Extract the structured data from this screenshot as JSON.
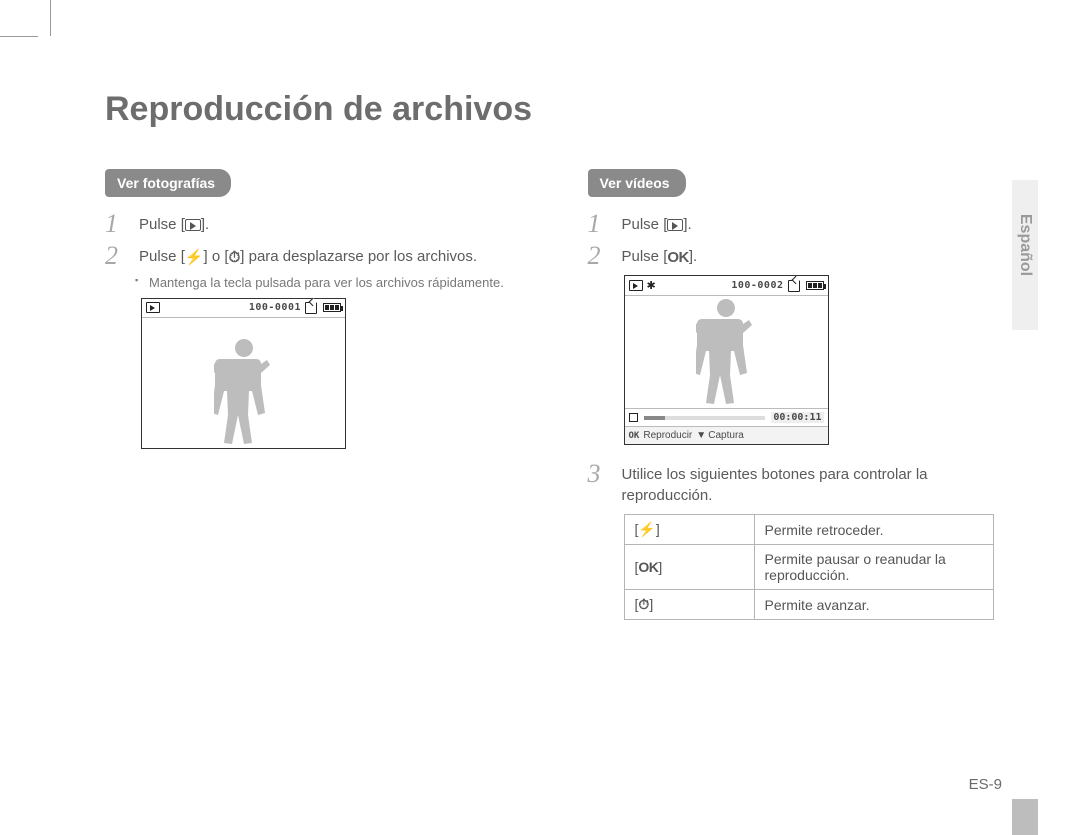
{
  "title": "Reproducción de archivos",
  "language_tab": "Español",
  "page_number": "ES-9",
  "photos": {
    "heading": "Ver fotografías",
    "step1_a": "Pulse [",
    "step1_b": "].",
    "step2_a": "Pulse [",
    "step2_b": "] o [",
    "step2_c": "] para desplazarse por los archivos.",
    "step2_sub": "Mantenga la tecla pulsada para ver los archivos rápidamente.",
    "screen_file": "100-0001"
  },
  "videos": {
    "heading": "Ver vídeos",
    "step1_a": "Pulse [",
    "step1_b": "].",
    "step2_a": "Pulse [",
    "step2_b": "].",
    "step3": "Utilice los siguientes botones para controlar la reproducción.",
    "screen_file": "100-0002",
    "time": "00:00:11",
    "bottom_play": "Reproducir",
    "bottom_capture": "Captura",
    "table": {
      "r1_desc": "Permite retroceder.",
      "r2_desc": "Permite pausar o reanudar la reproducción.",
      "r3_desc": "Permite avanzar."
    }
  },
  "icons": {
    "flash": "⚡",
    "timer": "⏱",
    "ok": "OK",
    "down": "▼",
    "star": "✱"
  }
}
